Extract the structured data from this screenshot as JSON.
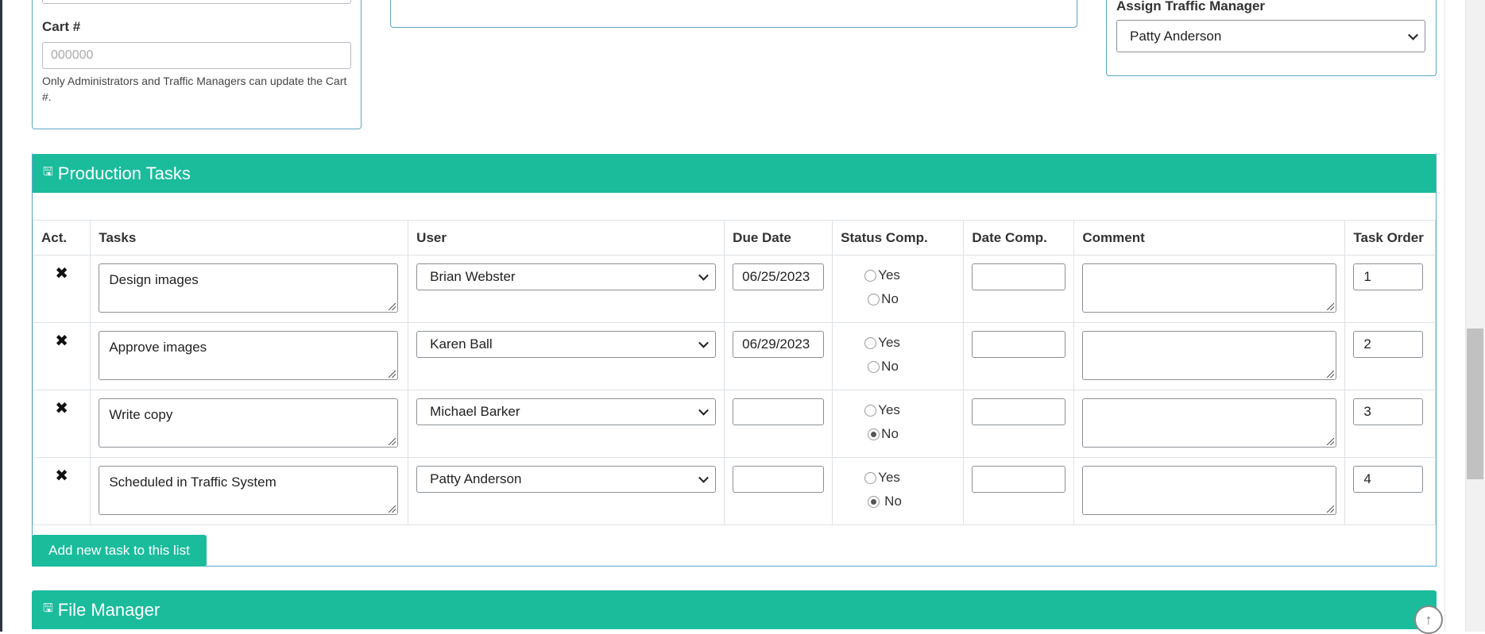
{
  "cart": {
    "label": "Cart #",
    "placeholder": "000000",
    "help": "Only Administrators and Traffic Managers can update the Cart #."
  },
  "traffic": {
    "label": "Assign Traffic Manager",
    "selected": "Patty Anderson"
  },
  "production": {
    "title": "Production Tasks",
    "icon": "save-icon",
    "columns": [
      "Act.",
      "Tasks",
      "User",
      "Due Date",
      "Status Comp.",
      "Date Comp.",
      "Comment",
      "Task Order"
    ],
    "yes_label": "Yes",
    "no_label": "No",
    "delete_glyph": "✖",
    "rows": [
      {
        "task": "Design images",
        "user": "Brian Webster",
        "due": "06/25/2023",
        "status": "none",
        "order": "1"
      },
      {
        "task": "Approve images",
        "user": "Karen Ball",
        "due": "06/29/2023",
        "status": "none",
        "order": "2"
      },
      {
        "task": "Write copy",
        "user": "Michael Barker",
        "due": "",
        "status": "no",
        "order": "3"
      },
      {
        "task": "Scheduled in Traffic System",
        "user": "Patty Anderson",
        "due": "",
        "status": "no",
        "order": "4"
      }
    ],
    "add_button": "Add new task to this list"
  },
  "file_manager": {
    "title": "File Manager",
    "icon": "save-icon"
  },
  "colors": {
    "accent": "#1abc9c",
    "panel_border": "#5aa6c9"
  }
}
